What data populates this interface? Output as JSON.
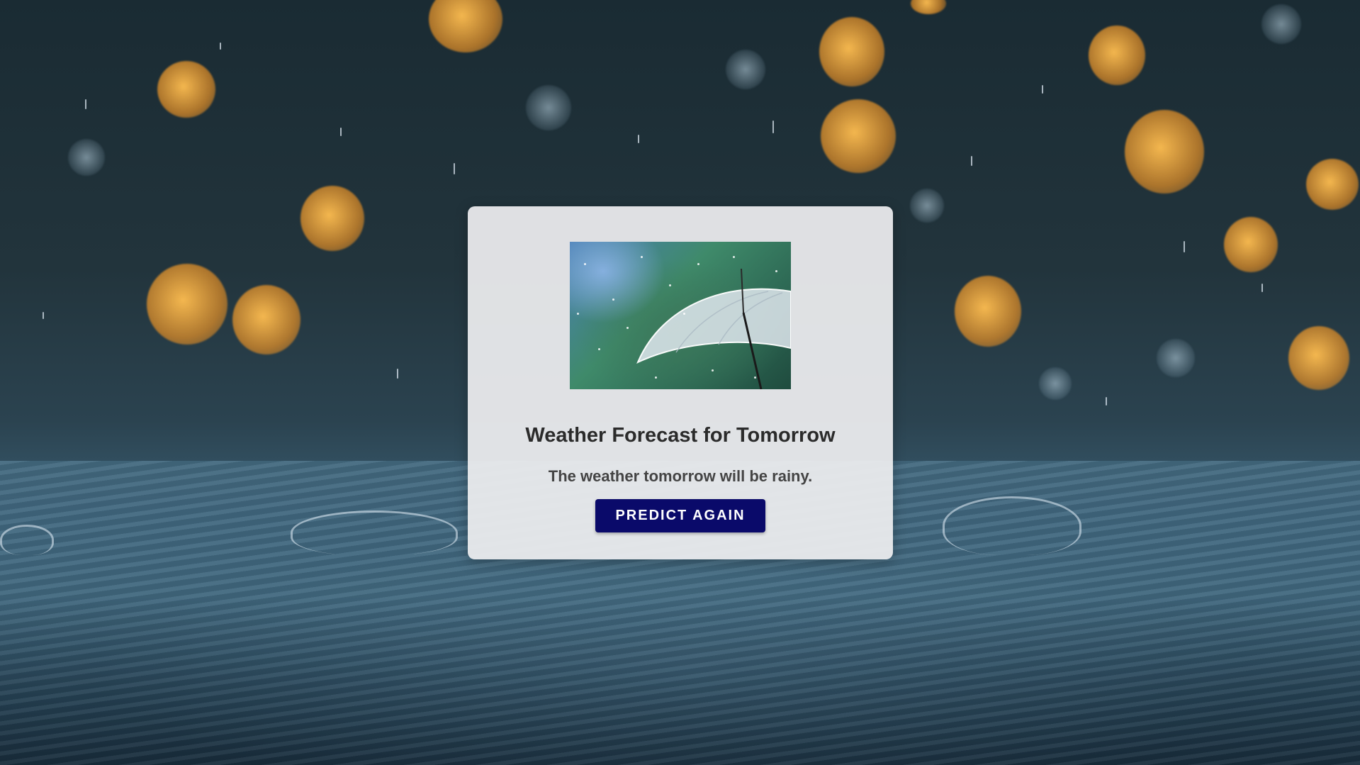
{
  "card": {
    "title": "Weather Forecast for Tomorrow",
    "message": "The weather tomorrow will be rainy.",
    "button_label": "PREDICT AGAIN",
    "button_color": "#0a0a6a",
    "image_icon": "umbrella-in-rain-icon"
  },
  "background": {
    "theme": "rain-splash-bokeh",
    "accent_warm": "#e8a23a",
    "accent_cool": "#3a5d72"
  }
}
